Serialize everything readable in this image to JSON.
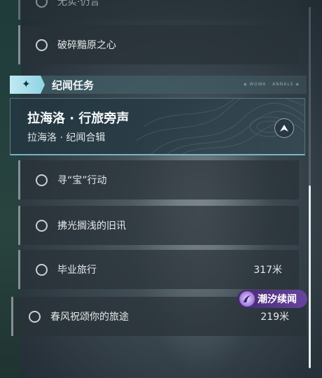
{
  "quests_above": [
    {
      "label": "无实·仍言",
      "kind": "partially-visible"
    },
    {
      "label": "破碎黯原之心"
    }
  ],
  "section": {
    "title": "纪闻任务",
    "icon": "four-point-star-icon",
    "decoration_text": "◈ WUWA · ANNALS ◈",
    "accent_color": "#bfe9f3"
  },
  "featured": {
    "title": "拉海洛 · 行旅旁声",
    "subtitle": "拉海洛 · 纪闻合辑",
    "icon": "navigate-arrow-icon"
  },
  "quests": [
    {
      "label": "寻“宝”行动",
      "distance": ""
    },
    {
      "label": "拂光搁浅的旧讯",
      "distance": ""
    },
    {
      "label": "毕业旅行",
      "distance": "317米"
    },
    {
      "label": "春风祝颂你的旅途",
      "distance": "219米"
    }
  ],
  "badge": {
    "text": "潮汐续闻",
    "icon": "tidal-swirl-icon",
    "color": "#6e46aa"
  }
}
